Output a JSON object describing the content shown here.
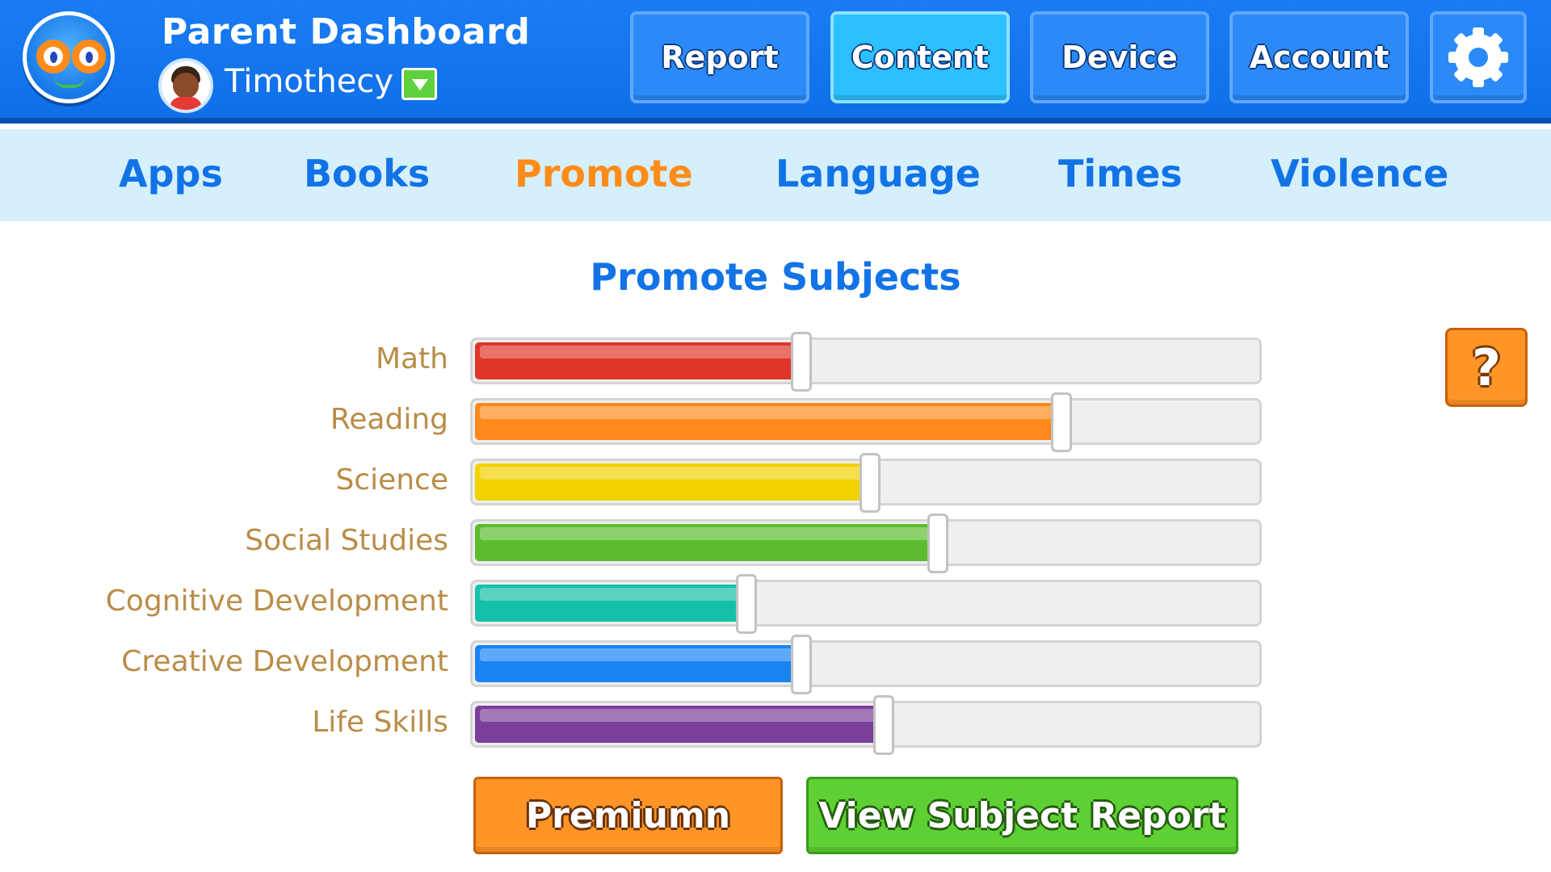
{
  "header": {
    "title": "Parent Dashboard",
    "user_name": "Timothecy",
    "buttons": {
      "report": "Report",
      "content": "Content",
      "device": "Device",
      "account": "Account"
    }
  },
  "subnav": {
    "items": [
      "Apps",
      "Books",
      "Promote",
      "Language",
      "Times",
      "Violence"
    ],
    "active": "Promote"
  },
  "main": {
    "title": "Promote Subjects",
    "help_label": "?",
    "subjects": [
      {
        "label": "Math",
        "level": 0.415,
        "color": "#e0362a"
      },
      {
        "label": "Reading",
        "level": 0.745,
        "color": "#ff8a1c"
      },
      {
        "label": "Science",
        "level": 0.502,
        "color": "#f2d200"
      },
      {
        "label": "Social Studies",
        "level": 0.588,
        "color": "#5cbc2e"
      },
      {
        "label": "Cognitive Development",
        "level": 0.345,
        "color": "#14c1a8"
      },
      {
        "label": "Creative Development",
        "level": 0.415,
        "color": "#1a84f5"
      },
      {
        "label": "Life Skills",
        "level": 0.52,
        "color": "#7a3f9a"
      }
    ],
    "premium_label": "Premiumn",
    "report_label": "View Subject Report"
  },
  "colors": {
    "brand_blue": "#1273e6",
    "active_orange": "#ff8c1a",
    "header_blue": "#1a7cf4",
    "label_tan": "#b98d48"
  }
}
